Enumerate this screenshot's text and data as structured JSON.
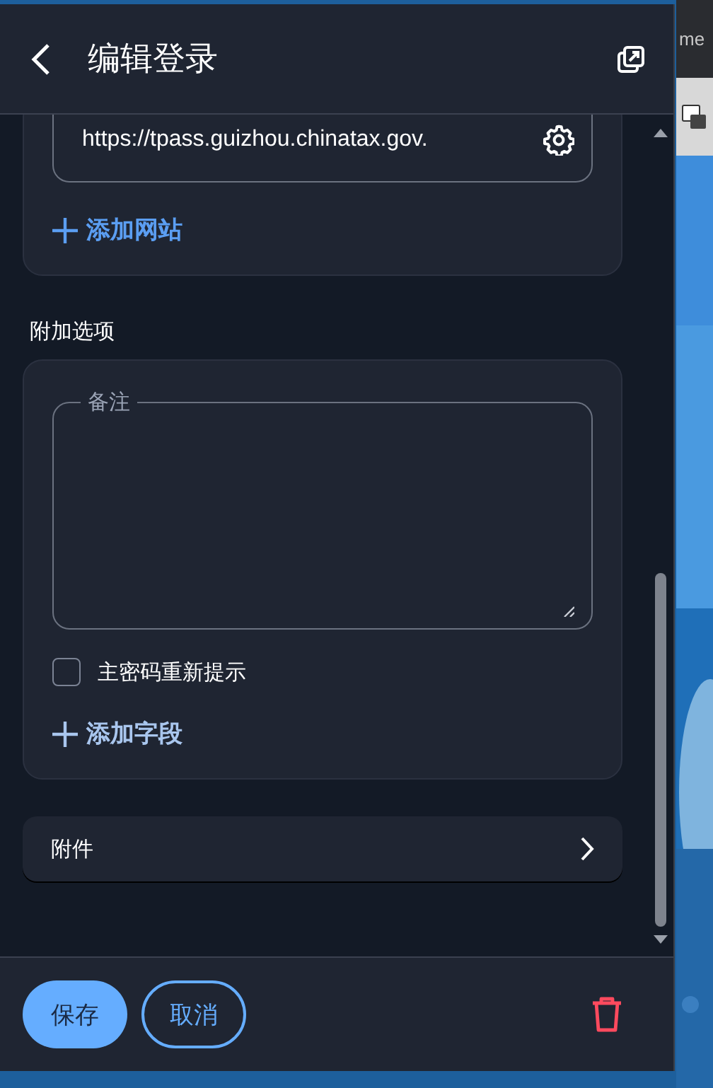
{
  "header": {
    "title": "编辑登录"
  },
  "websites": {
    "url": "https://tpass.guizhou.chinatax.gov.",
    "add_label": "添加网站"
  },
  "options": {
    "heading": "附加选项",
    "notes_label": "备注",
    "reprompt": {
      "label": "主密码重新提示",
      "checked": false
    },
    "add_label": "添加字段"
  },
  "attachments": {
    "label": "附件"
  },
  "footer": {
    "save": "保存",
    "cancel": "取消"
  },
  "background": {
    "tab_text": "me"
  }
}
